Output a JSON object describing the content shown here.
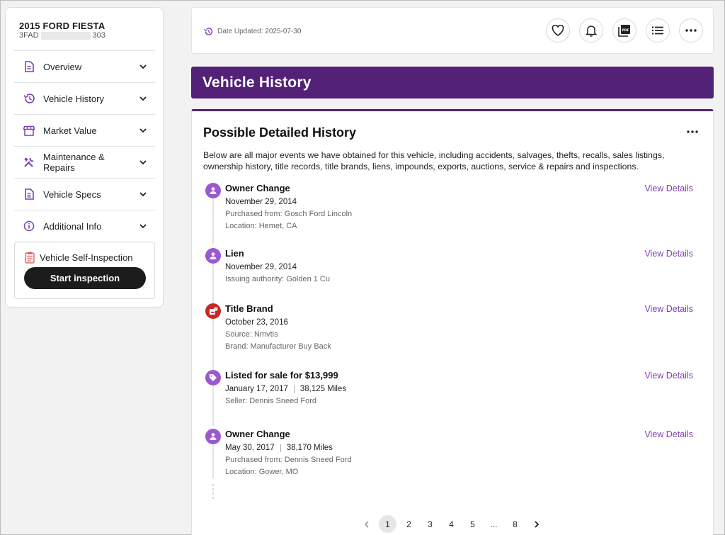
{
  "vehicle": {
    "title": "2015 FORD FIESTA",
    "vin_prefix": "3FAD",
    "vin_suffix": "303"
  },
  "sidebar": {
    "items": [
      {
        "label": "Overview",
        "icon": "document-icon"
      },
      {
        "label": "Vehicle History",
        "icon": "history-icon"
      },
      {
        "label": "Market Value",
        "icon": "store-icon"
      },
      {
        "label": "Maintenance & Repairs",
        "icon": "tools-icon"
      },
      {
        "label": "Vehicle Specs",
        "icon": "specs-icon"
      },
      {
        "label": "Additional Info",
        "icon": "info-icon"
      }
    ],
    "inspection": {
      "label": "Vehicle Self-Inspection",
      "button": "Start inspection"
    }
  },
  "topbar": {
    "updated": "Date Updated: 2025-07-30",
    "actions": [
      "heart-icon",
      "bell-icon",
      "pdf-icon",
      "list-icon",
      "more-icon"
    ]
  },
  "banner": {
    "title": "Vehicle History"
  },
  "history": {
    "title": "Possible Detailed History",
    "description": "Below are all major events we have obtained for this vehicle, including accidents, salvages, thefts, recalls, sales listings, ownership history, title records, title brands, liens, impounds, exports, auctions, service & repairs and inspections.",
    "view_label": "View Details",
    "events": [
      {
        "title": "Owner Change",
        "date": "November 29, 2014",
        "miles": "",
        "lines": [
          "Purchased from: Gosch Ford Lincoln",
          "Location: Hemet, CA"
        ],
        "icon": "person-icon"
      },
      {
        "title": "Lien",
        "date": "November 29, 2014",
        "miles": "",
        "lines": [
          "Issuing authority: Golden 1 Cu"
        ],
        "icon": "person-icon"
      },
      {
        "title": "Title Brand",
        "date": "October 23, 2016",
        "miles": "",
        "lines": [
          "Source: Nmvtis",
          "Brand: Manufacturer Buy Back"
        ],
        "icon": "title-brand-icon"
      },
      {
        "title": "Listed for sale for $13,999",
        "date": "January 17, 2017",
        "miles": "38,125 Miles",
        "lines": [
          "Seller: Dennis Sneed Ford"
        ],
        "icon": "tag-icon"
      },
      {
        "title": "Owner Change",
        "date": "May 30, 2017",
        "miles": "38,170 Miles",
        "lines": [
          "Purchased from: Dennis Sneed Ford",
          "Location: Gower, MO"
        ],
        "icon": "person-icon"
      }
    ]
  },
  "pagination": {
    "pages": [
      "1",
      "2",
      "3",
      "4",
      "5",
      "...",
      "8"
    ],
    "current": "1"
  },
  "colors": {
    "brand_purple": "#532178",
    "event_purple": "#9b59d0",
    "alert_red": "#c62828",
    "link_purple": "#7e3fb3"
  }
}
